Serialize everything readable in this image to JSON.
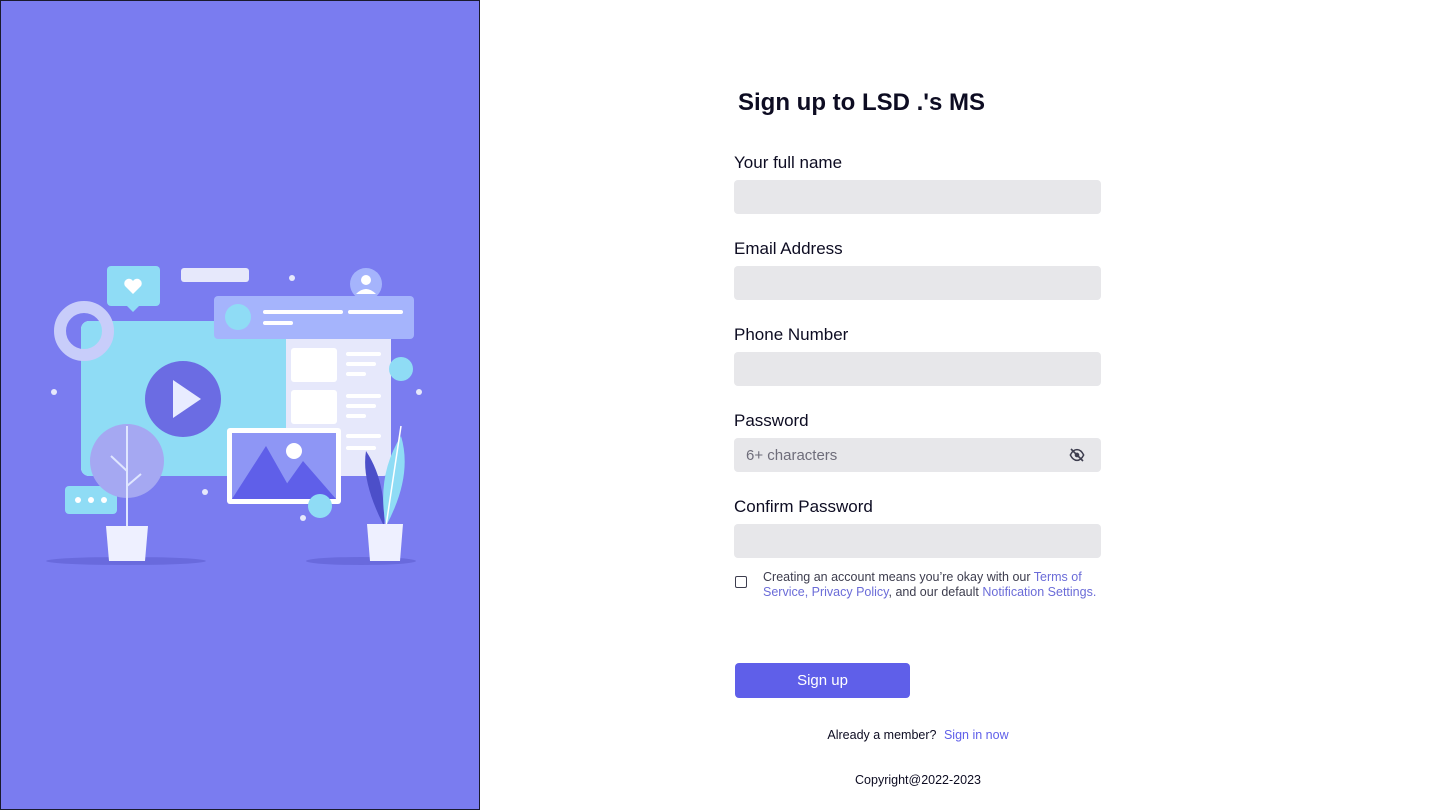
{
  "colors": {
    "left_panel_bg": "#7a7cf0",
    "accent": "#5f5fe9",
    "input_bg": "#e7e7ea",
    "link": "#6b6cd8"
  },
  "illustration": {
    "icon": "video-content-illustration"
  },
  "form": {
    "title": "Sign up to LSD .'s MS",
    "full_name": {
      "label": "Your full name",
      "value": "",
      "placeholder": ""
    },
    "email": {
      "label": "Email Address",
      "value": "",
      "placeholder": ""
    },
    "phone": {
      "label": "Phone Number",
      "value": "",
      "placeholder": ""
    },
    "password": {
      "label": "Password",
      "value": "",
      "placeholder": "6+ characters",
      "toggle_icon": "eye-off-icon"
    },
    "confirm_password": {
      "label": "Confirm Password",
      "value": "",
      "placeholder": ""
    },
    "agreement": {
      "checked": false,
      "text_1": "Creating an account means you’re okay with our ",
      "terms_link": "Terms of Service",
      "sep": ", ",
      "privacy_link": "Privacy Policy",
      "text_2": ", and our default ",
      "notification_link": "Notification Settings",
      "text_3": "."
    },
    "submit_label": "Sign up",
    "member_text": "Already a member?",
    "signin_link": "Sign in now"
  },
  "footer": {
    "copyright": "Copyright@2022-2023"
  }
}
